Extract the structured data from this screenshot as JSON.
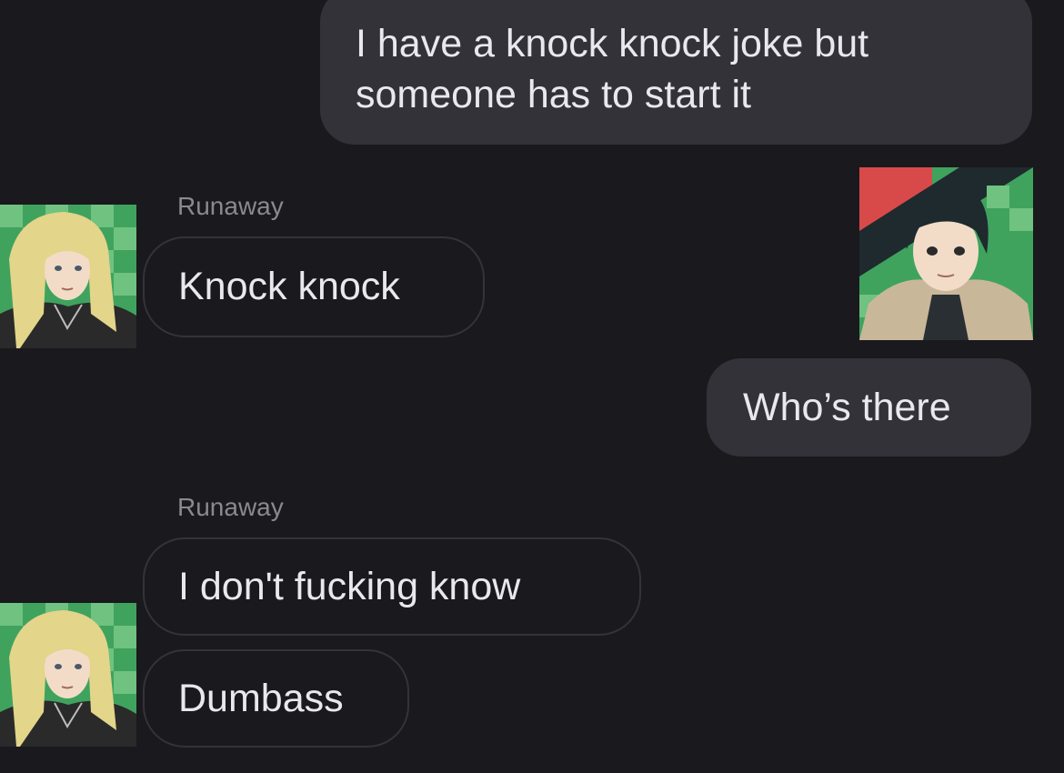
{
  "conversation": {
    "messages": [
      {
        "direction": "outgoing",
        "text_line1": "I have a knock knock joke but",
        "text_line2": "someone has to start it"
      },
      {
        "direction": "incoming",
        "sender": "Runaway",
        "text": "Knock knock"
      },
      {
        "direction": "outgoing",
        "text": "Who’s there"
      },
      {
        "direction": "incoming",
        "sender": "Runaway",
        "text": "I don't fucking know"
      },
      {
        "direction": "incoming",
        "text": "Dumbass"
      }
    ]
  },
  "avatars": {
    "other_user": {
      "icon": "blonde-anime-character-avatar",
      "colors": [
        "#3fa35e",
        "#6fc27f",
        "#e3d58a",
        "#2a2a2a"
      ]
    },
    "self": {
      "icon": "dark-haired-anime-character-avatar",
      "colors": [
        "#d84a4a",
        "#3fa35e",
        "#1e2a2e",
        "#c9b79a"
      ]
    }
  },
  "theme": {
    "background": "#1a191e",
    "outgoing_bubble": "#333239",
    "incoming_border": "#34333a",
    "text": "#e9e8ee",
    "sender_text": "#8a8990"
  }
}
